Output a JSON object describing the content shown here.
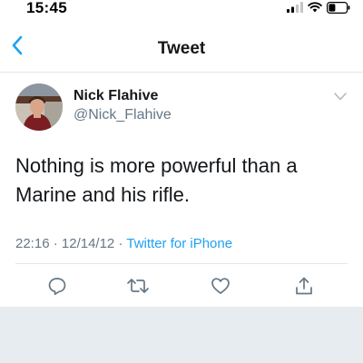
{
  "status_bar": {
    "time": "15:45",
    "icons": [
      "cellular-signal-icon",
      "wifi-icon",
      "battery-icon"
    ]
  },
  "nav": {
    "back_icon": "chevron-left-icon",
    "title": "Tweet"
  },
  "tweet": {
    "author_name": "Nick Flahive",
    "author_handle": "@Nick_Flahive",
    "text": "Nothing is more powerful than a Marine and his rifle.",
    "time": "22:16",
    "separator": "·",
    "date": "12/14/12",
    "source": "Twitter for iPhone"
  },
  "actions": [
    "reply-icon",
    "retweet-icon",
    "like-icon",
    "share-icon"
  ],
  "colors": {
    "accent": "#1da1f2",
    "text_primary": "#14171a",
    "text_secondary": "#657786",
    "divider": "#e1e8ed",
    "background_gray": "#e6ecf0"
  }
}
